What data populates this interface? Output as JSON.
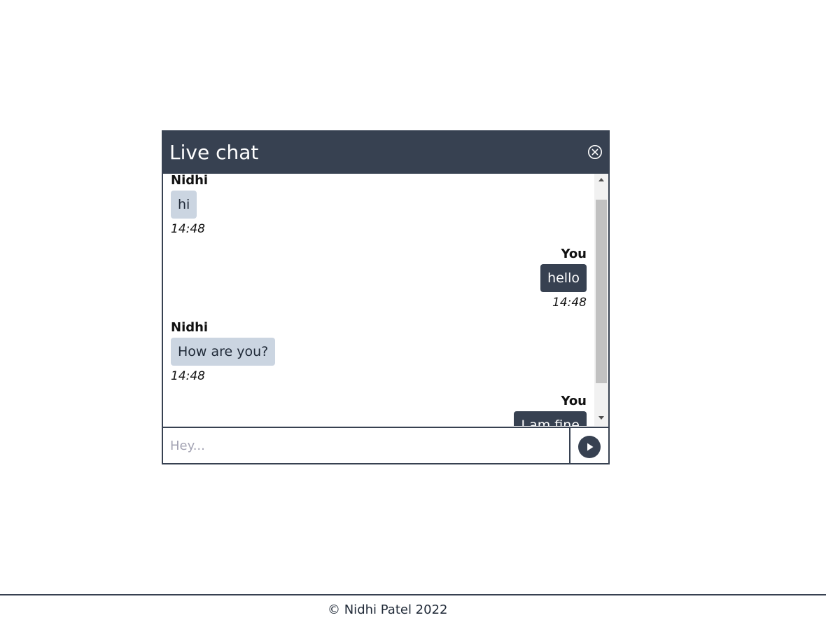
{
  "chat": {
    "title": "Live chat",
    "close_icon": "close-circle-icon",
    "messages": [
      {
        "sender": "Nidhi",
        "text": "hi",
        "time": "14:48",
        "side": "left"
      },
      {
        "sender": "You",
        "text": "hello",
        "time": "14:48",
        "side": "right"
      },
      {
        "sender": "Nidhi",
        "text": "How are you?",
        "time": "14:48",
        "side": "left"
      },
      {
        "sender": "You",
        "text": "I am fine",
        "side": "right"
      }
    ],
    "input": {
      "placeholder": "Hey...",
      "value": ""
    },
    "send_icon": "play-circle-icon"
  },
  "footer": {
    "text": "© Nidhi Patel 2022"
  },
  "colors": {
    "header": "#374151",
    "bubble_in": "#cbd5e1",
    "bubble_out": "#374151"
  }
}
